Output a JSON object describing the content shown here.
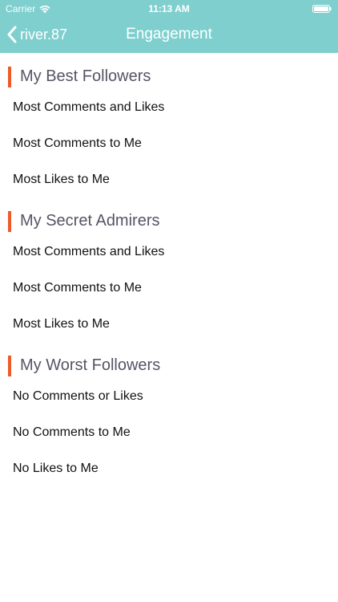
{
  "colors": {
    "accent": "#7fcfcf",
    "section_marker": "#ee5a28",
    "section_title": "#555566",
    "text": "#111111"
  },
  "status_bar": {
    "carrier": "Carrier",
    "time": "11:13 AM",
    "icons": [
      "wifi-icon",
      "battery-icon"
    ]
  },
  "nav": {
    "back_label": "river.87",
    "back_icon": "chevron-left-icon",
    "title": "Engagement"
  },
  "sections": [
    {
      "title": "My Best Followers",
      "items": [
        {
          "label": "Most Comments and Likes"
        },
        {
          "label": "Most Comments to Me"
        },
        {
          "label": "Most Likes to Me"
        }
      ]
    },
    {
      "title": "My Secret Admirers",
      "items": [
        {
          "label": "Most Comments and Likes"
        },
        {
          "label": "Most Comments to Me"
        },
        {
          "label": "Most Likes to Me"
        }
      ]
    },
    {
      "title": "My Worst Followers",
      "items": [
        {
          "label": "No Comments or Likes"
        },
        {
          "label": "No Comments to Me"
        },
        {
          "label": "No Likes to Me"
        }
      ]
    }
  ]
}
